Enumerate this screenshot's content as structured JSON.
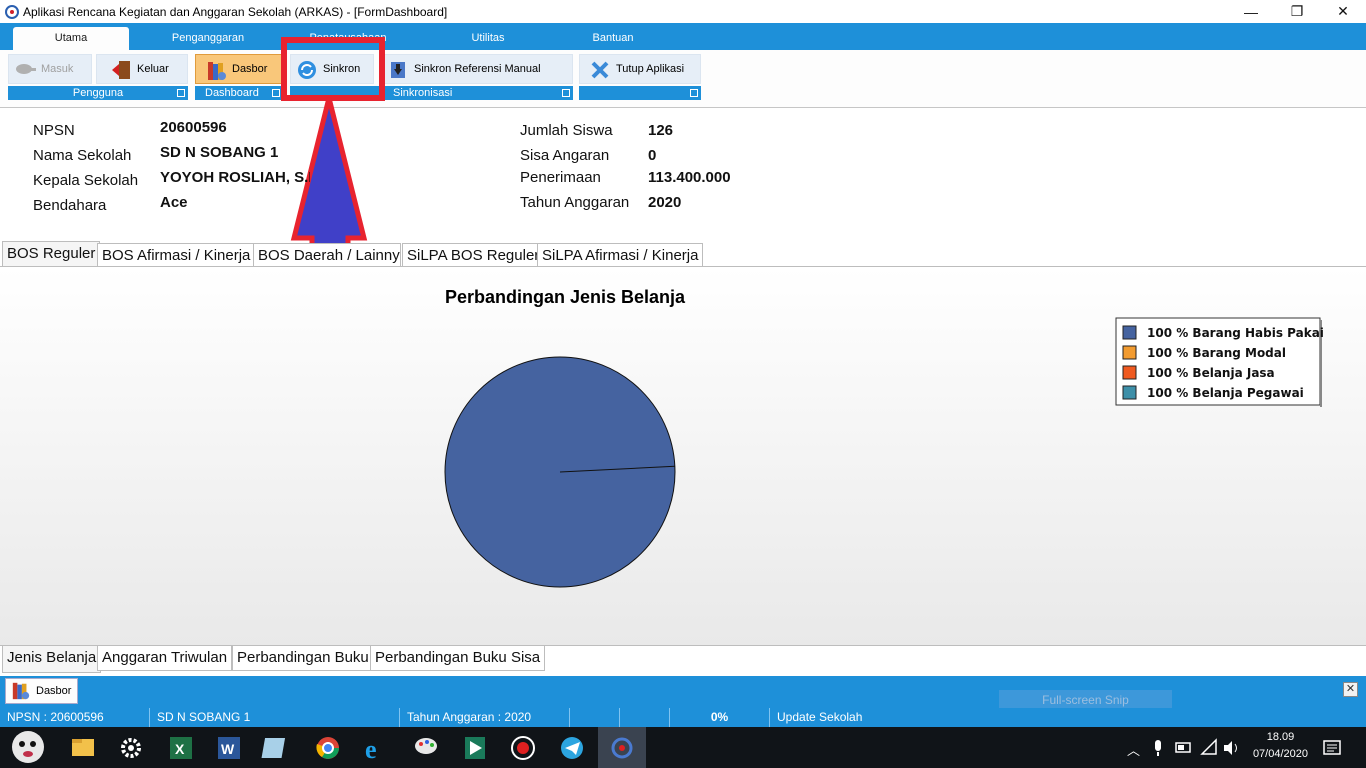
{
  "window": {
    "title": "Aplikasi Rencana Kegiatan dan Anggaran Sekolah (ARKAS) - [FormDashboard]",
    "minimize": "—",
    "restore": "❐",
    "close": "✕"
  },
  "ribbon": {
    "tabs": [
      "Utama",
      "Penganggaran",
      "Penatausahaan",
      "Utilitas",
      "Bantuan"
    ],
    "buttons": {
      "masuk": "Masuk",
      "keluar": "Keluar",
      "dasbor": "Dasbor",
      "sinkron": "Sinkron",
      "sinkron_ref": "Sinkron Referensi Manual",
      "tutup": "Tutup Aplikasi"
    },
    "groups": [
      "Pengguna",
      "Dashboard",
      "Sinkronisasi"
    ]
  },
  "school": {
    "npsn_label": "NPSN",
    "npsn": "20600596",
    "nama_label": "Nama Sekolah",
    "nama": "SD N SOBANG 1",
    "kepala_label": "Kepala Sekolah",
    "kepala": "YOYOH ROSLIAH, S.Pd",
    "bendahara_label": "Bendahara",
    "bendahara": "Ace",
    "siswa_label": "Jumlah Siswa",
    "siswa": "126",
    "sisa_label": "Sisa Angaran",
    "sisa": "0",
    "penerimaan_label": "Penerimaan",
    "penerimaan": "113.400.000",
    "tahun_label": "Tahun Anggaran",
    "tahun": "2020"
  },
  "fund_tabs": [
    "BOS Reguler",
    "BOS Afirmasi / Kinerja",
    "BOS Daerah / Lainnya",
    "SiLPA BOS Reguler",
    "SiLPA Afirmasi / Kinerja"
  ],
  "chart_data": {
    "type": "pie",
    "title": "Perbandingan Jenis Belanja",
    "legend_placement": "top-right",
    "slices": [
      {
        "label": "Barang Habis Pakai",
        "percent_text": "100 %",
        "value": 100,
        "color": "#4563a0"
      },
      {
        "label": "Barang Modal",
        "percent_text": "100 %",
        "value": 0,
        "color": "#f29b30"
      },
      {
        "label": "Belanja Jasa",
        "percent_text": "100 %",
        "value": 0,
        "color": "#ef5a20"
      },
      {
        "label": "Belanja Pegawai",
        "percent_text": "100 %",
        "value": 0,
        "color": "#3d8fa8"
      }
    ]
  },
  "chart_tabs": [
    "Jenis Belanja",
    "Anggaran Triwulan",
    "Perbandingan Buku",
    "Perbandingan Buku Sisa"
  ],
  "mdi": {
    "tab_label": "Dasbor",
    "close": "✕"
  },
  "snip_label": "Full-screen Snip",
  "status": {
    "npsn": "NPSN : 20600596",
    "sekolah": "SD N SOBANG 1",
    "tahun": "Tahun Anggaran : 2020",
    "progress": "0%",
    "message": "Update Sekolah"
  },
  "taskbar": {
    "time": "18.09",
    "date": "07/04/2020"
  },
  "colors": {
    "ribbon_blue": "#1e90d9",
    "highlight_red": "#e8232f",
    "arrow_blue": "#4040c8"
  }
}
